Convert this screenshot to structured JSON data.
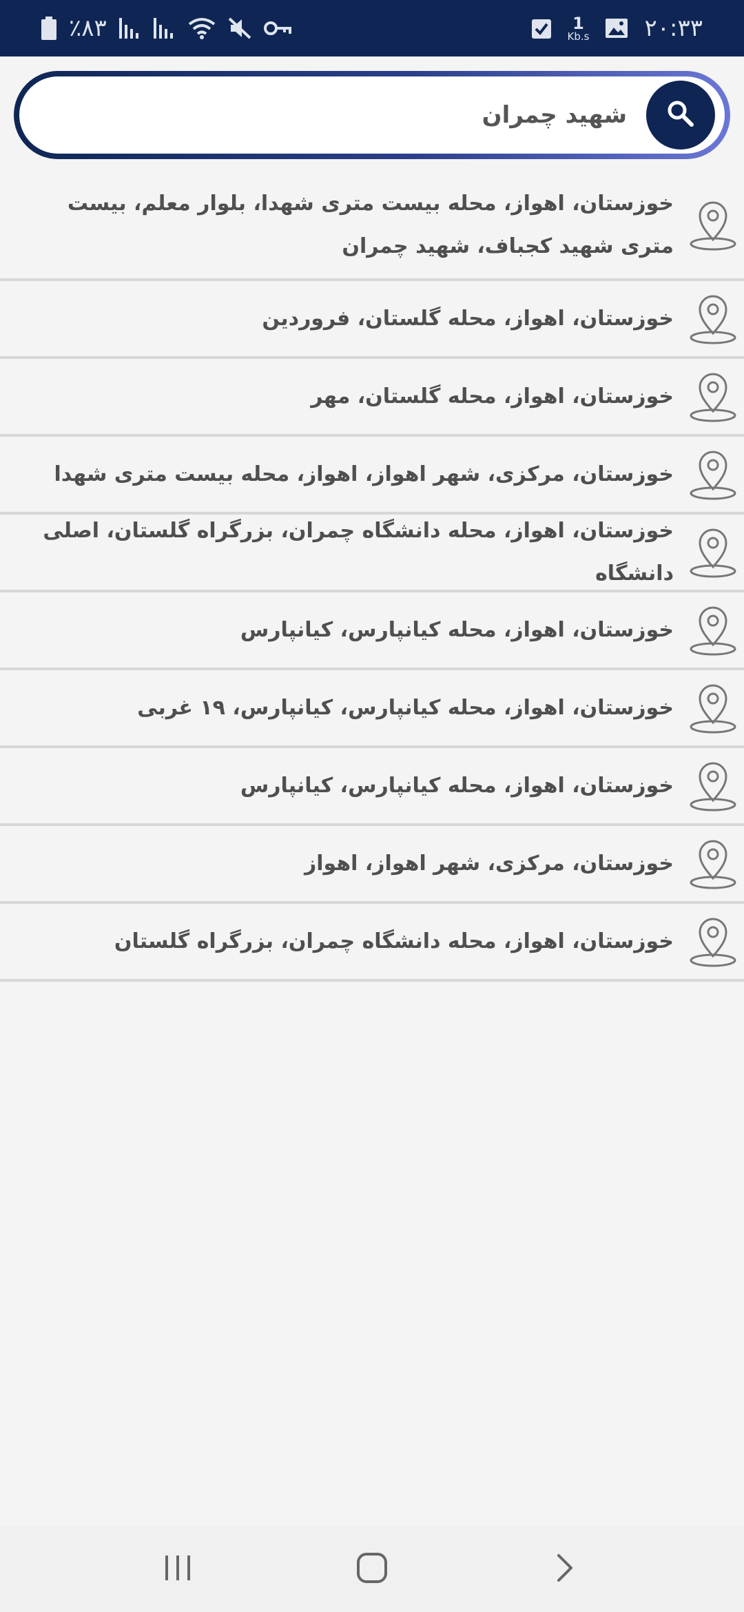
{
  "status_bar": {
    "time": "۲۰:۳۳",
    "speed_value": "1",
    "speed_unit": "Kb.s",
    "battery": "٪۸۳",
    "icons": [
      "image-icon",
      "checkbox-icon",
      "battery-icon",
      "signal-icon",
      "signal-icon",
      "wifi-icon",
      "mute-icon",
      "vpn-key-icon"
    ]
  },
  "search": {
    "value": "شهید چمران",
    "icon": "search-icon"
  },
  "results": [
    {
      "address": "خوزستان، اهواز، محله بیست متری شهدا، بلوار معلم، بیست متری شهید کجباف، شهید چمران",
      "icon": "location-pin-icon"
    },
    {
      "address": "خوزستان، اهواز، محله گلستان، فروردین",
      "icon": "location-pin-icon"
    },
    {
      "address": "خوزستان، اهواز، محله گلستان، مهر",
      "icon": "location-pin-icon"
    },
    {
      "address": "خوزستان، مرکزی، شهر اهواز، اهواز، محله بیست متری شهدا",
      "icon": "location-pin-icon"
    },
    {
      "address": "خوزستان، اهواز، محله دانشگاه چمران، بزرگراه گلستان، اصلی دانشگاه",
      "icon": "location-pin-icon"
    },
    {
      "address": "خوزستان، اهواز، محله کیانپارس، کیانپارس",
      "icon": "location-pin-icon"
    },
    {
      "address": "خوزستان، اهواز، محله کیانپارس، کیانپارس، ۱۹ غربی",
      "icon": "location-pin-icon"
    },
    {
      "address": "خوزستان، اهواز، محله کیانپارس، کیانپارس",
      "icon": "location-pin-icon"
    },
    {
      "address": "خوزستان، مرکزی، شهر اهواز، اهواز",
      "icon": "location-pin-icon"
    },
    {
      "address": "خوزستان، اهواز، محله دانشگاه چمران، بزرگراه گلستان",
      "icon": "location-pin-icon"
    }
  ],
  "nav_bar": {
    "icons": [
      "recent-apps-icon",
      "home-icon",
      "back-icon"
    ]
  },
  "colors": {
    "primary": "#0f2654",
    "accent_gradient_end": "#6b77d6",
    "background": "#f4f4f4",
    "text": "#4f4f4f",
    "divider": "#d7d7d7"
  }
}
